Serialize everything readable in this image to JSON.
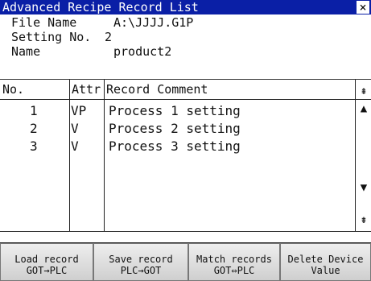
{
  "window": {
    "title": "Advanced Recipe Record List",
    "close_glyph": "×"
  },
  "info": {
    "file_name_label": "File Name",
    "file_name_value": "A:\\JJJJ.G1P",
    "setting_no_label": "Setting No.",
    "setting_no_value": "2",
    "name_label": "Name",
    "name_value": "product2"
  },
  "table": {
    "headers": {
      "no": "No.",
      "attr": "Attr",
      "comment": "Record Comment"
    },
    "rows": [
      {
        "no": "1",
        "attr": "VP",
        "comment": "Process 1 setting"
      },
      {
        "no": "2",
        "attr": "V",
        "comment": "Process 2 setting"
      },
      {
        "no": "3",
        "attr": "V",
        "comment": "Process 3 setting"
      }
    ]
  },
  "scrollbar": {
    "top_glyph": "⇞",
    "up_glyph": "▲",
    "down_glyph": "▼",
    "bottom_glyph": "⇟"
  },
  "buttons": [
    {
      "line1": "Load record",
      "line2": "GOT→PLC"
    },
    {
      "line1": "Save record",
      "line2": "PLC→GOT"
    },
    {
      "line1": "Match records",
      "line2": "GOT⇔PLC"
    },
    {
      "line1": "Delete Device",
      "line2": "Value"
    }
  ],
  "colors": {
    "title_bar": "#0a1fa6",
    "title_text": "#ffffff"
  }
}
